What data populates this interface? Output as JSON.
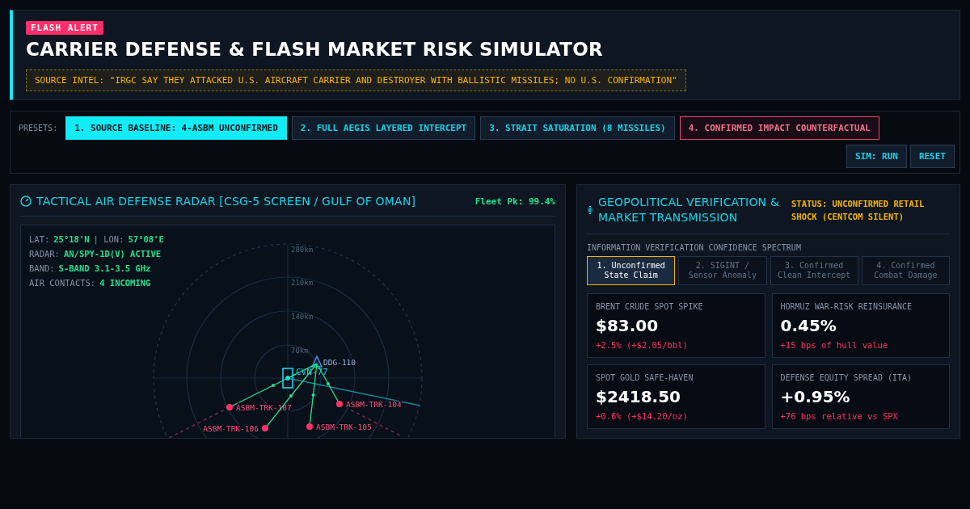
{
  "header": {
    "badge": "FLASH ALERT",
    "title": "CARRIER DEFENSE & FLASH MARKET RISK SIMULATOR",
    "intel": "SOURCE INTEL: \"IRGC SAY THEY ATTACKED U.S. AIRCRAFT CARRIER AND DESTROYER WITH BALLISTIC MISSILES; NO U.S. CONFIRMATION\""
  },
  "presets": {
    "label": "PRESETS:",
    "items": [
      {
        "label": "1. SOURCE BASELINE: 4-ASBM UNCONFIRMED",
        "selected": true,
        "kind": "standard"
      },
      {
        "label": "2. FULL AEGIS LAYERED INTERCEPT",
        "selected": false,
        "kind": "standard"
      },
      {
        "label": "3. STRAIT SATURATION (8 MISSILES)",
        "selected": false,
        "kind": "standard"
      },
      {
        "label": "4. CONFIRMED IMPACT COUNTERFACTUAL",
        "selected": false,
        "kind": "danger"
      }
    ],
    "actions": [
      "SIM: RUN",
      "RESET"
    ]
  },
  "radar": {
    "title": "TACTICAL AIR DEFENSE RADAR [CSG-5 SCREEN / GULF OF OMAN]",
    "fleet_pk": "Fleet Pk: 99.4%",
    "readouts": [
      {
        "parts": [
          {
            "label": "LAT:",
            "value": "25°18'N"
          },
          {
            "label": "| LON:",
            "value": "57°08'E"
          }
        ]
      },
      {
        "parts": [
          {
            "label": "RADAR:",
            "value": "AN/SPY-1D(V) ACTIVE"
          }
        ]
      },
      {
        "parts": [
          {
            "label": "BAND:",
            "value": "S-BAND 3.1-3.5 GHz"
          }
        ]
      },
      {
        "parts": [
          {
            "label": "AIR CONTACTS:",
            "value": "4 INCOMING"
          }
        ]
      }
    ],
    "rings": [
      "280km",
      "210km",
      "140km",
      "70km"
    ],
    "contacts": [
      {
        "kind": "carrier",
        "label": "CVN-77"
      },
      {
        "kind": "destroyer",
        "label": "DDG-110"
      },
      {
        "kind": "hostile",
        "label": "ASBM-TRK-107"
      },
      {
        "kind": "hostile",
        "label": "ASBM-TRK-106"
      },
      {
        "kind": "hostile",
        "label": "ASBM-TRK-105"
      },
      {
        "kind": "hostile",
        "label": "ASBM-TRK-104"
      }
    ]
  },
  "market": {
    "title": "GEOPOLITICAL VERIFICATION & MARKET TRANSMISSION",
    "status": "STATUS: UNCONFIRMED RETAIL SHOCK (CENTCOM SILENT)",
    "spectrum_label": "INFORMATION VERIFICATION CONFIDENCE SPECTRUM",
    "steps": [
      {
        "label": "1. Unconfirmed State Claim",
        "selected": true
      },
      {
        "label": "2. SIGINT / Sensor Anomaly",
        "selected": false
      },
      {
        "label": "3. Confirmed Clean Intercept",
        "selected": false
      },
      {
        "label": "4. Confirmed Combat Damage",
        "selected": false
      }
    ],
    "metrics": [
      {
        "label": "BRENT CRUDE SPOT SPIKE",
        "value": "$83.00",
        "change": "+2.5% (+$2.05/bbl)"
      },
      {
        "label": "HORMUZ WAR-RISK REINSURANCE",
        "value": "0.45%",
        "change": "+15 bps of hull value"
      },
      {
        "label": "SPOT GOLD SAFE-HAVEN",
        "value": "$2418.50",
        "change": "+0.6% (+$14.20/oz)"
      },
      {
        "label": "DEFENSE EQUITY SPREAD (ITA)",
        "value": "+0.95%",
        "change": "+76 bps relative vs SPX"
      }
    ]
  }
}
